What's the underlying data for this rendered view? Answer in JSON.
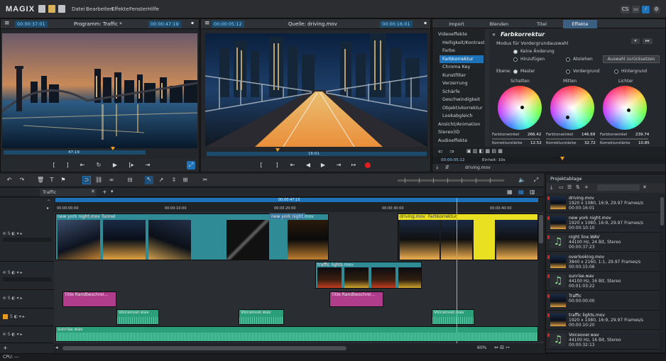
{
  "app": {
    "logo": "MAGIX",
    "menu": [
      "Datei",
      "Bearbeiten",
      "Effekte",
      "Fenster",
      "Hilfe"
    ],
    "top_right": [
      "CS",
      "",
      "",
      ""
    ]
  },
  "program_monitor": {
    "tc_left": "00:00:37:01",
    "title": "Programm: Traffic *",
    "tc_right": "00:00:47:19",
    "scrub_tc": "47:19"
  },
  "source_monitor": {
    "tc_left": "00:00:05:12",
    "title": "Quelle: driving.mov",
    "tc_right": "00:00:16:01",
    "scrub_tc": "16:01"
  },
  "effects": {
    "tabs": [
      "Import",
      "Blenden",
      "Titel",
      "Effekte"
    ],
    "active_tab": "Effekte",
    "categories": [
      {
        "label": "Videoeffekte",
        "type": "header"
      },
      {
        "label": "Helligkeit/Kontrast",
        "type": "item"
      },
      {
        "label": "Farbe",
        "type": "item"
      },
      {
        "label": "Farbkorrektur",
        "type": "selected"
      },
      {
        "label": "Chroma Key",
        "type": "item"
      },
      {
        "label": "Kunstfilter",
        "type": "item"
      },
      {
        "label": "Verzerrung",
        "type": "item"
      },
      {
        "label": "Schärfe",
        "type": "item"
      },
      {
        "label": "Geschwindigkeit",
        "type": "item"
      },
      {
        "label": "Objektivkorrektur",
        "type": "item"
      },
      {
        "label": "Lookabgleich",
        "type": "item"
      },
      {
        "label": "Ansicht/Animation",
        "type": "header"
      },
      {
        "label": "Stereo3D",
        "type": "header"
      },
      {
        "label": "Audioeffekte",
        "type": "header"
      }
    ],
    "title": "Farbkorrektur",
    "mode_label": "Modus für Vordergrundauswahl",
    "mode_options": [
      "Keine Änderung",
      "Hinzufügen",
      "Abziehen"
    ],
    "reset_button": "Auswahl zurücksetzen",
    "level_label": "Ebene:",
    "level_options": [
      "Master",
      "Vordergrund",
      "Hintergrund"
    ],
    "wheels": [
      {
        "name": "Schatten",
        "hue_label": "Farbtonwinkel",
        "hue": "266.42",
        "strength_label": "Korrekturstärke",
        "strength": "12.52"
      },
      {
        "name": "Mitten",
        "hue_label": "Farbtonwinkel",
        "hue": "146.69",
        "strength_label": "Korrekturstärke",
        "strength": "32.72"
      },
      {
        "name": "Lichter",
        "hue_label": "Farbtonwinkel",
        "hue": "239.74",
        "strength_label": "Korrekturstärke",
        "strength": "10.85"
      }
    ],
    "footer_tc": "00:00:05:12",
    "footer_unit": "Einheit: 10s",
    "footer_clip": "driving.mov"
  },
  "timeline": {
    "tab": "Traffic",
    "ruler_top": "00:00:47:15",
    "ruler": [
      "00:00:00:00",
      "00:00:10:00",
      "00:00:20:00",
      "00:00:30:00",
      "00:00:40:00"
    ],
    "clips": {
      "c1": "new york night.mov",
      "c2": "Tunnel",
      "c3": "new york night.mov",
      "c4": "driving.mov",
      "c5": "Farbkorrektur",
      "c6": "traffic lights.mov",
      "t1": "Title  Randbeschrei...",
      "t2": "Title  Randbeschrei...",
      "a1": "Voiceover.wav",
      "a2": "Voiceover.wav",
      "a3": "Voiceover.wav",
      "m1": "sunrise.wav"
    },
    "zoom": "60%",
    "cpu": "CPU: ---"
  },
  "project": {
    "title": "Projektablage",
    "items": [
      {
        "name": "driving.mov",
        "line2": "1920 x 1080, 16:9, 29.97 Frames/s",
        "line3": "00:00:16:01",
        "kind": "video"
      },
      {
        "name": "new york night.mov",
        "line2": "1920 x 1080, 16:9, 29.97 Frames/s",
        "line3": "00:00:10:10",
        "kind": "video"
      },
      {
        "name": "night line.WAV",
        "line2": "44100 Hz, 24 Bit, Stereo",
        "line3": "00:00:37:23",
        "kind": "audio"
      },
      {
        "name": "overlooking.mov",
        "line2": "3840 x 2160, 1:1, 29.97 Frames/s",
        "line3": "00:00:15:06",
        "kind": "video"
      },
      {
        "name": "sunrise.wav",
        "line2": "44100 Hz, 16 Bit, Stereo",
        "line3": "00:01:03:22",
        "kind": "audio"
      },
      {
        "name": "Traffic",
        "line2": "00:00:00:00",
        "line3": "",
        "kind": "video"
      },
      {
        "name": "traffic lights.mov",
        "line2": "1920 x 1080, 16:9, 29.97 Frames/s",
        "line3": "00:00:10:20",
        "kind": "video"
      },
      {
        "name": "Voiceover.wav",
        "line2": "44100 Hz, 16 Bit, Stereo",
        "line3": "00:00:32:13",
        "kind": "audio"
      }
    ]
  },
  "colors": {
    "accent": "#1e73b8",
    "video_clip": "#2f8b95",
    "title_clip": "#b03c8c",
    "audio_clip": "#2b9e7a",
    "fx_clip": "#e8e020",
    "playhead": "#f0a020"
  }
}
